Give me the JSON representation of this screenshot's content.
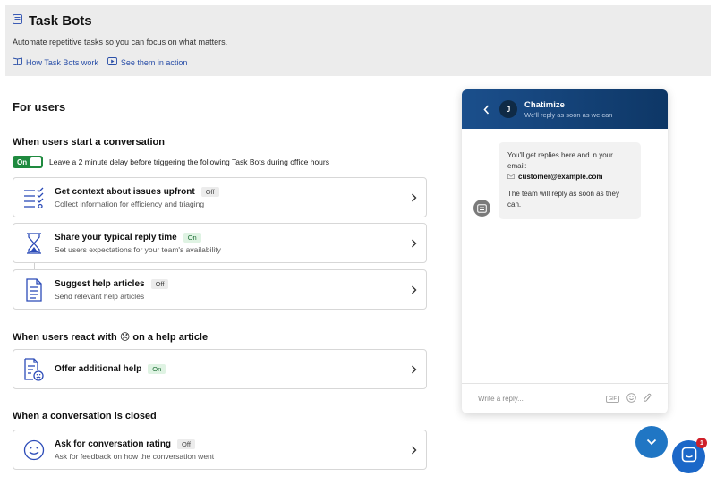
{
  "header": {
    "title": "Task Bots",
    "description": "Automate repetitive tasks so you can focus on what matters.",
    "links": [
      {
        "label": "How Task Bots work",
        "icon": "book-icon"
      },
      {
        "label": "See them in action",
        "icon": "play-icon"
      }
    ]
  },
  "main": {
    "for_users": "For users",
    "section_start": {
      "title": "When users start a conversation",
      "toggle_label": "On",
      "delay_text": "Leave a 2 minute delay before triggering the following Task Bots during",
      "office_hours": "office hours"
    },
    "cards": [
      {
        "title": "Get context about issues upfront",
        "badge": "Off",
        "subtitle": "Collect information for efficiency and triaging",
        "icon": "checklist-icon"
      },
      {
        "title": "Share your typical reply time",
        "badge": "On",
        "subtitle": "Set users expectations for your team's availability",
        "icon": "hourglass-icon"
      },
      {
        "title": "Suggest help articles",
        "badge": "Off",
        "subtitle": "Send relevant help articles",
        "icon": "document-icon"
      },
      {
        "title": "Offer additional help",
        "badge": "On",
        "subtitle": "",
        "icon": "document-face-icon"
      },
      {
        "title": "Ask for conversation rating",
        "badge": "Off",
        "subtitle": "Ask for feedback on how the conversation went",
        "icon": "smiley-icon"
      }
    ],
    "section_react": {
      "title_before": "When users react with",
      "emoji": "😞",
      "title_after": "on a help article"
    },
    "section_closed": {
      "title": "When a conversation is closed"
    }
  },
  "widget": {
    "avatar_initial": "J",
    "name": "Chatimize",
    "status": "We'll reply as soon as we can",
    "message_intro": "You'll get replies here and in your email:",
    "email": "customer@example.com",
    "message_outro": "The team will reply as soon as they can.",
    "composer_placeholder": "Write a reply...",
    "gif_label": "GIF"
  },
  "launcher": {
    "notification_count": "1"
  },
  "colors": {
    "toggle_on": "#1f8a3f",
    "header_gradient_start": "#1b4f8c",
    "launcher": "#1b67c8",
    "notification": "#d0202a"
  }
}
